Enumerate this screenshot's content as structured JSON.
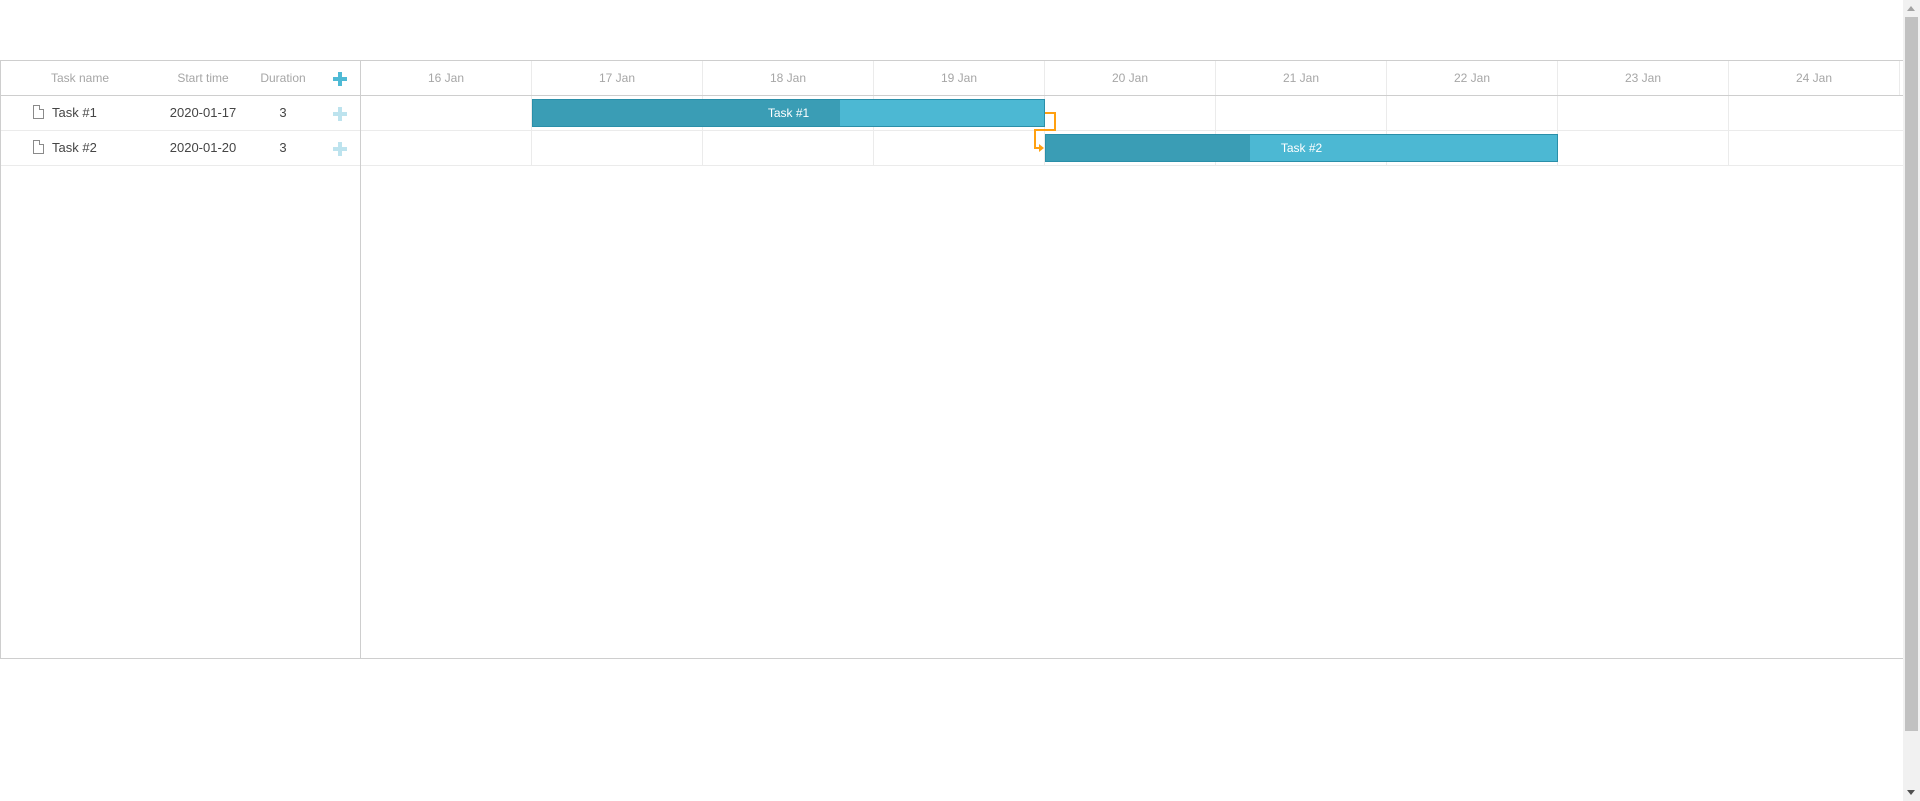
{
  "grid": {
    "columns": {
      "name": "Task name",
      "start": "Start time",
      "duration": "Duration",
      "add_icon": "plus-icon"
    },
    "rows": [
      {
        "name": "Task #1",
        "start": "2020-01-17",
        "duration": "3"
      },
      {
        "name": "Task #2",
        "start": "2020-01-20",
        "duration": "3"
      }
    ]
  },
  "timeline": {
    "days": [
      "16 Jan",
      "17 Jan",
      "18 Jan",
      "19 Jan",
      "20 Jan",
      "21 Jan",
      "22 Jan",
      "23 Jan",
      "24 Jan"
    ],
    "tasks": [
      {
        "name": "Task #1",
        "start_day": "17 Jan",
        "duration_days": 3,
        "progress": 0.6
      },
      {
        "name": "Task #2",
        "start_day": "20 Jan",
        "duration_days": 3,
        "progress": 0.4
      }
    ],
    "links": [
      {
        "from": "Task #1",
        "to": "Task #2",
        "type": "finish-to-start"
      }
    ]
  },
  "colors": {
    "bar": "#4cb8d3",
    "bar_progress": "#3a9db5",
    "bar_border": "#2a8fa9",
    "link": "#ffa011",
    "add_icon": "#4fbad5"
  }
}
